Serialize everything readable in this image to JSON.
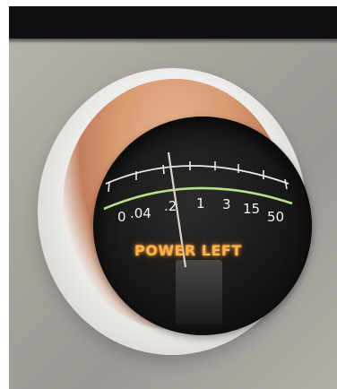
{
  "scale": {
    "labels": [
      "0",
      ".04",
      ".2",
      "1",
      "3",
      "15",
      "50"
    ]
  },
  "indicator": {
    "label": "POWER LEFT"
  },
  "colors": {
    "band": "#0f0f12",
    "bezel": "#f2f1ef",
    "glow": "#d89a72",
    "dial": "#181716",
    "scale_arc": "#b7e08a",
    "scale_text": "#f2f2f2",
    "indicator_text": "#ffb24a"
  }
}
